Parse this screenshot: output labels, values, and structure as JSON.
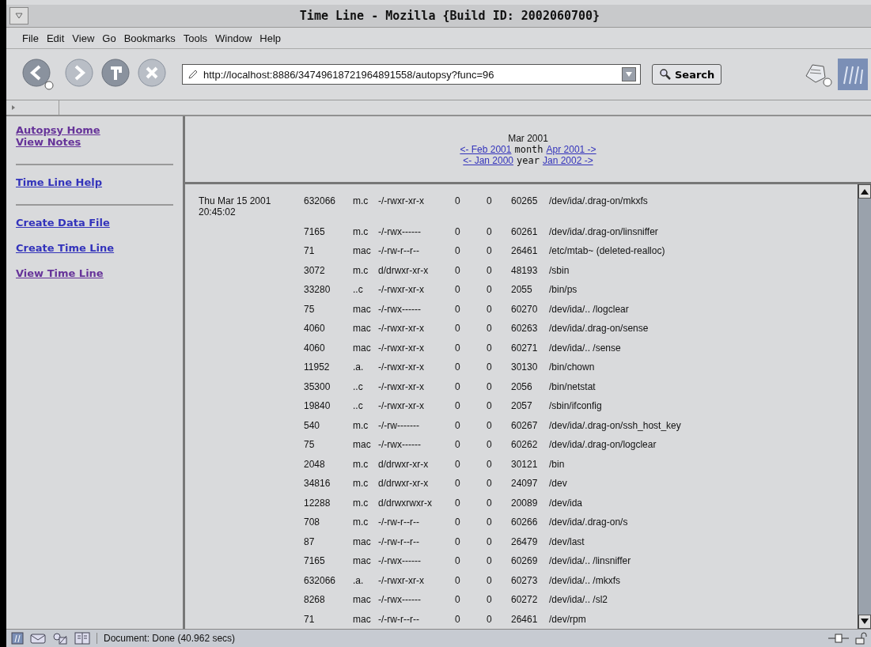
{
  "window": {
    "title": "Time Line - Mozilla {Build ID: 2002060700}"
  },
  "menu": [
    "File",
    "Edit",
    "View",
    "Go",
    "Bookmarks",
    "Tools",
    "Window",
    "Help"
  ],
  "toolbar": {
    "buttons": [
      {
        "kind": "back",
        "disabled": false
      },
      {
        "kind": "forward",
        "disabled": true
      },
      {
        "kind": "reload",
        "disabled": false
      },
      {
        "kind": "stop",
        "disabled": true
      }
    ],
    "url": "http://localhost:8886/34749618721964891558/autopsy?func=96",
    "search": "Search"
  },
  "sidebar": {
    "groups": [
      [
        {
          "label": "Autopsy Home",
          "visited": true
        },
        {
          "label": "View Notes",
          "visited": true
        }
      ],
      [
        {
          "label": "Time Line Help",
          "visited": false
        }
      ],
      [
        {
          "label": "Create Data File",
          "visited": false
        },
        {
          "label": "Create Time Line",
          "visited": false
        },
        {
          "label": "View Time Line",
          "visited": true
        }
      ]
    ]
  },
  "header": {
    "current": "Mar 2001",
    "month_nav": {
      "prev": "<- Feb 2001",
      "label": "month",
      "next": "Apr 2001 ->"
    },
    "year_nav": {
      "prev": "<- Jan 2000",
      "label": "year",
      "next": "Jan 2002 ->"
    }
  },
  "table": {
    "rows": [
      {
        "date": "Thu Mar 15 2001",
        "time": "20:45:02",
        "size": "632066",
        "activity": "m.c",
        "perms": "-/-rwxr-xr-x",
        "uid": "0",
        "gid": "0",
        "inode": "60265",
        "name": "/dev/ida/.drag-on/mkxfs"
      },
      {
        "size": "7165",
        "activity": "m.c",
        "perms": "-/-rwx------",
        "uid": "0",
        "gid": "0",
        "inode": "60261",
        "name": "/dev/ida/.drag-on/linsniffer"
      },
      {
        "size": "71",
        "activity": "mac",
        "perms": "-/-rw-r--r--",
        "uid": "0",
        "gid": "0",
        "inode": "26461",
        "name": "/etc/mtab~ (deleted-realloc)"
      },
      {
        "size": "3072",
        "activity": "m.c",
        "perms": "d/drwxr-xr-x",
        "uid": "0",
        "gid": "0",
        "inode": "48193",
        "name": "/sbin"
      },
      {
        "size": "33280",
        "activity": "..c",
        "perms": "-/-rwxr-xr-x",
        "uid": "0",
        "gid": "0",
        "inode": "2055",
        "name": "/bin/ps"
      },
      {
        "size": "75",
        "activity": "mac",
        "perms": "-/-rwx------",
        "uid": "0",
        "gid": "0",
        "inode": "60270",
        "name": "/dev/ida/.. /logclear"
      },
      {
        "size": "4060",
        "activity": "mac",
        "perms": "-/-rwxr-xr-x",
        "uid": "0",
        "gid": "0",
        "inode": "60263",
        "name": "/dev/ida/.drag-on/sense"
      },
      {
        "size": "4060",
        "activity": "mac",
        "perms": "-/-rwxr-xr-x",
        "uid": "0",
        "gid": "0",
        "inode": "60271",
        "name": "/dev/ida/.. /sense"
      },
      {
        "size": "11952",
        "activity": ".a.",
        "perms": "-/-rwxr-xr-x",
        "uid": "0",
        "gid": "0",
        "inode": "30130",
        "name": "/bin/chown"
      },
      {
        "size": "35300",
        "activity": "..c",
        "perms": "-/-rwxr-xr-x",
        "uid": "0",
        "gid": "0",
        "inode": "2056",
        "name": "/bin/netstat"
      },
      {
        "size": "19840",
        "activity": "..c",
        "perms": "-/-rwxr-xr-x",
        "uid": "0",
        "gid": "0",
        "inode": "2057",
        "name": "/sbin/ifconfig"
      },
      {
        "size": "540",
        "activity": "m.c",
        "perms": "-/-rw-------",
        "uid": "0",
        "gid": "0",
        "inode": "60267",
        "name": "/dev/ida/.drag-on/ssh_host_key"
      },
      {
        "size": "75",
        "activity": "mac",
        "perms": "-/-rwx------",
        "uid": "0",
        "gid": "0",
        "inode": "60262",
        "name": "/dev/ida/.drag-on/logclear"
      },
      {
        "size": "2048",
        "activity": "m.c",
        "perms": "d/drwxr-xr-x",
        "uid": "0",
        "gid": "0",
        "inode": "30121",
        "name": "/bin"
      },
      {
        "size": "34816",
        "activity": "m.c",
        "perms": "d/drwxr-xr-x",
        "uid": "0",
        "gid": "0",
        "inode": "24097",
        "name": "/dev"
      },
      {
        "size": "12288",
        "activity": "m.c",
        "perms": "d/drwxrwxr-x",
        "uid": "0",
        "gid": "0",
        "inode": "20089",
        "name": "/dev/ida"
      },
      {
        "size": "708",
        "activity": "m.c",
        "perms": "-/-rw-r--r--",
        "uid": "0",
        "gid": "0",
        "inode": "60266",
        "name": "/dev/ida/.drag-on/s"
      },
      {
        "size": "87",
        "activity": "mac",
        "perms": "-/-rw-r--r--",
        "uid": "0",
        "gid": "0",
        "inode": "26479",
        "name": "/dev/last"
      },
      {
        "size": "7165",
        "activity": "mac",
        "perms": "-/-rwx------",
        "uid": "0",
        "gid": "0",
        "inode": "60269",
        "name": "/dev/ida/.. /linsniffer"
      },
      {
        "size": "632066",
        "activity": ".a.",
        "perms": "-/-rwxr-xr-x",
        "uid": "0",
        "gid": "0",
        "inode": "60273",
        "name": "/dev/ida/.. /mkxfs"
      },
      {
        "size": "8268",
        "activity": "mac",
        "perms": "-/-rwx------",
        "uid": "0",
        "gid": "0",
        "inode": "60272",
        "name": "/dev/ida/.. /sl2"
      },
      {
        "size": "71",
        "activity": "mac",
        "perms": "-/-rw-r--r--",
        "uid": "0",
        "gid": "0",
        "inode": "26461",
        "name": "/dev/rpm"
      }
    ]
  },
  "status_bar": {
    "text": "Document: Done (40.962 secs)"
  }
}
